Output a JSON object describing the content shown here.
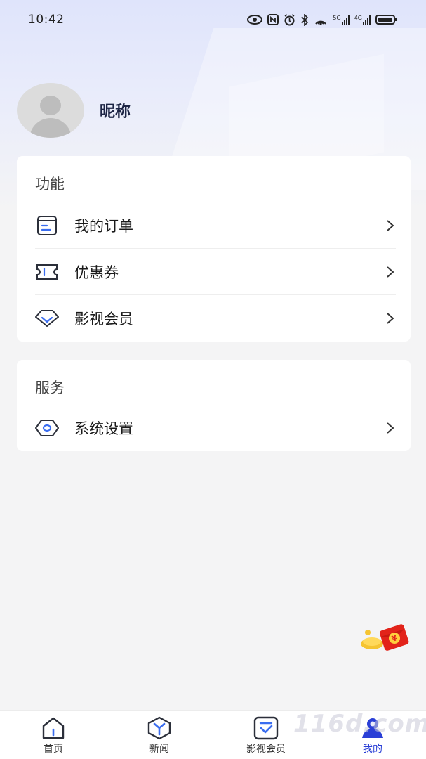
{
  "status_bar": {
    "time": "10:42",
    "icons": [
      "eye-icon",
      "nfc-icon",
      "alarm-icon",
      "bluetooth-icon",
      "hotspot-icon",
      "signal-5g-icon",
      "signal-4g-icon",
      "battery-icon"
    ],
    "net1": "5G",
    "net2": "4G"
  },
  "profile": {
    "nickname": "昵称"
  },
  "function_section": {
    "title": "功能",
    "items": [
      {
        "label": "我的订单",
        "icon": "order-icon"
      },
      {
        "label": "优惠券",
        "icon": "coupon-icon"
      },
      {
        "label": "影视会员",
        "icon": "diamond-icon"
      }
    ]
  },
  "service_section": {
    "title": "服务",
    "items": [
      {
        "label": "系统设置",
        "icon": "settings-icon"
      }
    ]
  },
  "floating": {
    "icon": "red-packet-icon",
    "symbol": "¥"
  },
  "tabbar": {
    "tabs": [
      {
        "label": "首页",
        "icon": "home-icon",
        "active": false
      },
      {
        "label": "新闻",
        "icon": "news-icon",
        "active": false
      },
      {
        "label": "影视会员",
        "icon": "vip-icon",
        "active": false
      },
      {
        "label": "我的",
        "icon": "profile-icon",
        "active": true
      }
    ],
    "active_color": "#2a3fd6"
  },
  "watermark": "116d.com"
}
